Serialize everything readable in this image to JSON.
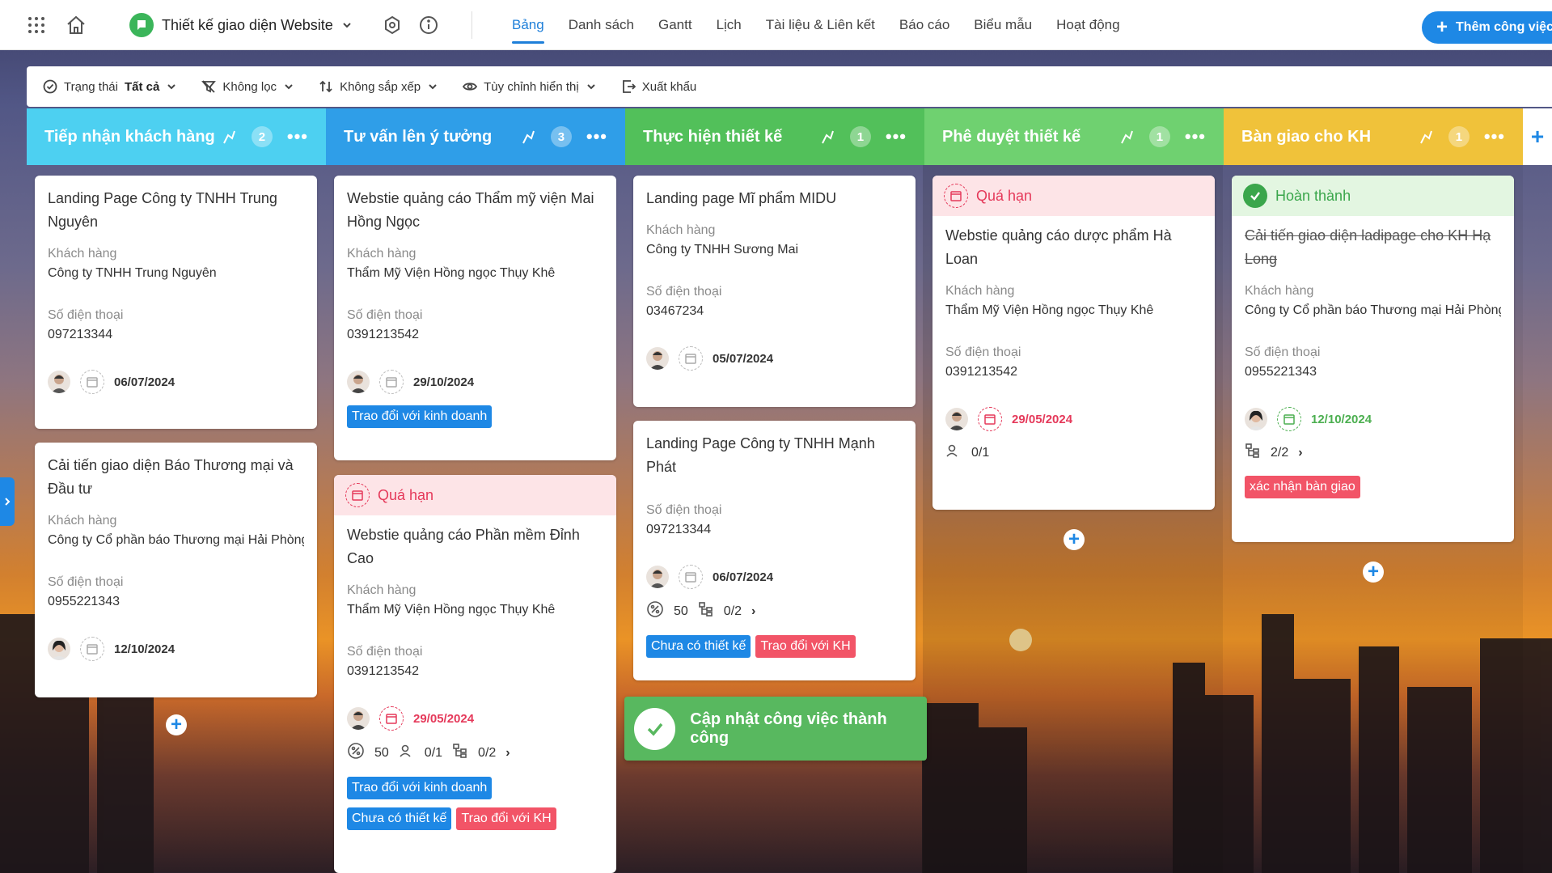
{
  "project": {
    "name": "Thiết kế giao diện Website"
  },
  "tabs": [
    "Bảng",
    "Danh sách",
    "Gantt",
    "Lịch",
    "Tài liệu & Liên kết",
    "Báo cáo",
    "Biểu mẫu",
    "Hoạt động"
  ],
  "active_tab": "Bảng",
  "add_button": "Thêm công việc",
  "filters": {
    "status_label": "Trạng thái",
    "status_value": "Tất cả",
    "filter": "Không lọc",
    "sort": "Không sắp xếp",
    "display": "Tùy chỉnh hiển thị",
    "export": "Xuất khẩu"
  },
  "labels": {
    "customer": "Khách hàng",
    "phone": "Số điện thoại"
  },
  "colors": {
    "col1": "#4dd0f1",
    "col2": "#2f9ee8",
    "col3": "#52c05a",
    "col4": "#6fd170",
    "col5": "#f0c23a",
    "overdue": "#e5395a",
    "done": "#3aa64b",
    "accent": "#1e88e5"
  },
  "columns": [
    {
      "title": "Tiếp nhận khách hàng",
      "count": "2"
    },
    {
      "title": "Tư vấn lên ý tưởng",
      "count": "3"
    },
    {
      "title": "Thực hiện thiết kế",
      "count": "1"
    },
    {
      "title": "Phê duyệt thiết kế",
      "count": "1"
    },
    {
      "title": "Bàn giao cho KH",
      "count": "1"
    }
  ],
  "cards": {
    "c1a": {
      "title": "Landing Page Công ty TNHH Trung Nguyên",
      "customer": "Công ty TNHH Trung Nguyên",
      "phone": "097213344",
      "date": "06/07/2024"
    },
    "c1b": {
      "title": "Cải tiến giao diện Báo Thương mại và Đầu tư",
      "customer": "Công ty Cổ phần báo Thương mại Hải Phòng",
      "phone": "0955221343",
      "date": "12/10/2024"
    },
    "c2a": {
      "title": "Webstie quảng cáo Thẩm mỹ viện Mai Hồng Ngọc",
      "customer": "Thẩm Mỹ Viện Hồng ngọc Thụy Khê",
      "phone": "0391213542",
      "date": "29/10/2024",
      "tag1": "Trao đổi với kinh doanh"
    },
    "c2b": {
      "status": "Quá hạn",
      "title": "Webstie quảng cáo Phần mềm Đỉnh Cao",
      "customer": "Thẩm Mỹ Viện Hồng ngọc Thụy Khê",
      "phone": "0391213542",
      "date": "29/05/2024",
      "progress": "50",
      "assignees": "0/1",
      "subtasks": "0/2",
      "tag1": "Trao đổi với kinh doanh",
      "tag2": "Chưa có thiết kế",
      "tag3": "Trao đổi với KH"
    },
    "c3a": {
      "title": "Landing page Mĩ phẩm MIDU",
      "customer": "Công ty TNHH Sương Mai",
      "phone": "03467234",
      "date": "05/07/2024"
    },
    "c3b": {
      "title": "Landing Page Công ty TNHH Mạnh Phát",
      "phone": "097213344",
      "date": "06/07/2024",
      "progress": "50",
      "subtasks": "0/2",
      "tag1": "Chưa có thiết kế",
      "tag2": "Trao đổi với KH"
    },
    "c4a": {
      "status": "Quá hạn",
      "title": "Webstie quảng cáo dược phẩm Hà Loan",
      "customer": "Thẩm Mỹ Viện Hồng ngọc Thụy Khê",
      "phone": "0391213542",
      "date": "29/05/2024",
      "assignees": "0/1"
    },
    "c5a": {
      "status": "Hoàn thành",
      "title": "Cải tiến giao diện ladipage cho KH Hạ Long",
      "customer": "Công ty Cổ phần báo Thương mại Hải Phòng",
      "phone": "0955221343",
      "date": "12/10/2024",
      "subtasks": "2/2",
      "tag1": "xác nhận bàn giao"
    }
  },
  "toast": "Cập nhật công việc thành công"
}
